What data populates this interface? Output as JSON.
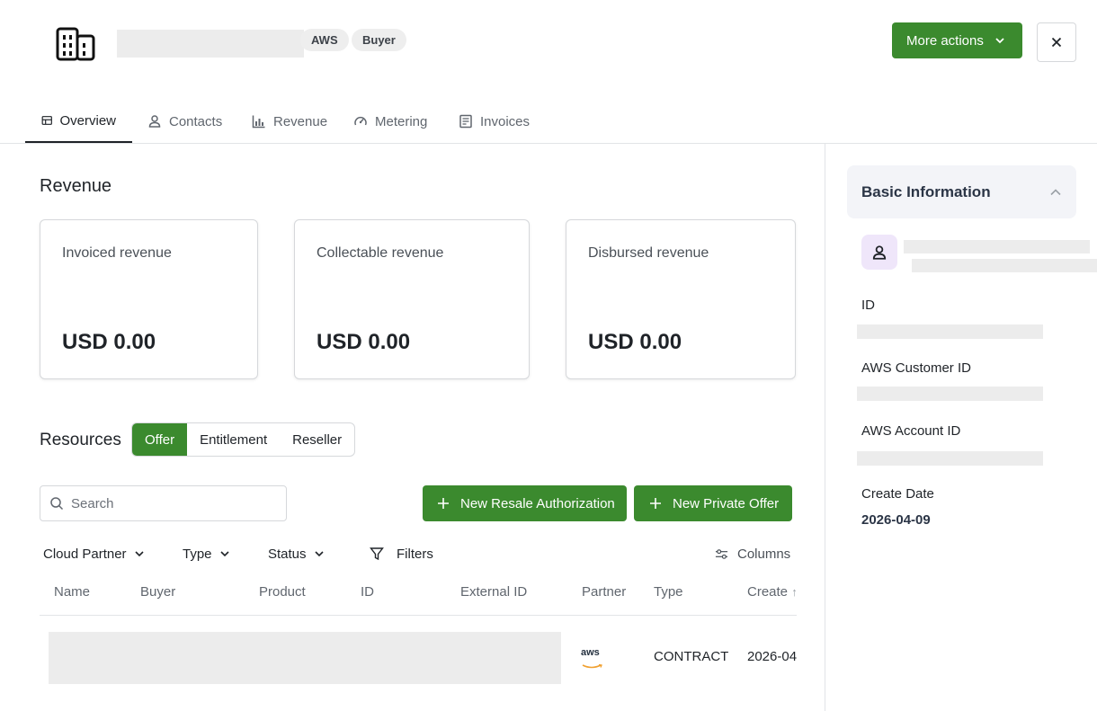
{
  "header": {
    "badges": [
      "AWS",
      "Buyer"
    ],
    "more_actions_label": "More actions",
    "icon": "building-icon"
  },
  "tabs": [
    {
      "label": "Overview",
      "icon": "layout-icon",
      "active": true
    },
    {
      "label": "Contacts",
      "icon": "person-icon"
    },
    {
      "label": "Revenue",
      "icon": "chart-icon"
    },
    {
      "label": "Metering",
      "icon": "gauge-icon"
    },
    {
      "label": "Invoices",
      "icon": "invoice-icon"
    }
  ],
  "revenue": {
    "title": "Revenue",
    "cards": [
      {
        "label": "Invoiced revenue",
        "value": "USD 0.00"
      },
      {
        "label": "Collectable revenue",
        "value": "USD 0.00"
      },
      {
        "label": "Disbursed revenue",
        "value": "USD 0.00"
      }
    ]
  },
  "resources": {
    "title": "Resources",
    "segments": [
      "Offer",
      "Entitlement",
      "Reseller"
    ],
    "selected_segment": "Offer",
    "search_placeholder": "Search",
    "new_resale_label": "New Resale Authorization",
    "new_private_offer_label": "New Private Offer",
    "filters": {
      "cloud_partner": "Cloud Partner",
      "type": "Type",
      "status": "Status",
      "filters": "Filters",
      "columns": "Columns"
    },
    "columns": [
      "Name",
      "Buyer",
      "Product",
      "ID",
      "External ID",
      "Partner",
      "Type",
      "Create"
    ],
    "rows": [
      {
        "partner_logo": "aws",
        "type": "CONTRACT",
        "create": "2026-04"
      }
    ]
  },
  "basic_info": {
    "title": "Basic Information",
    "fields": {
      "id_label": "ID",
      "aws_customer_id_label": "AWS Customer ID",
      "aws_account_id_label": "AWS Account ID",
      "create_date_label": "Create Date",
      "create_date_value": "2026-04-09"
    }
  },
  "colors": {
    "primary": "#3b8a2e",
    "panel_bg": "#f3f4f8",
    "avatar_bg": "#efe6fa"
  }
}
